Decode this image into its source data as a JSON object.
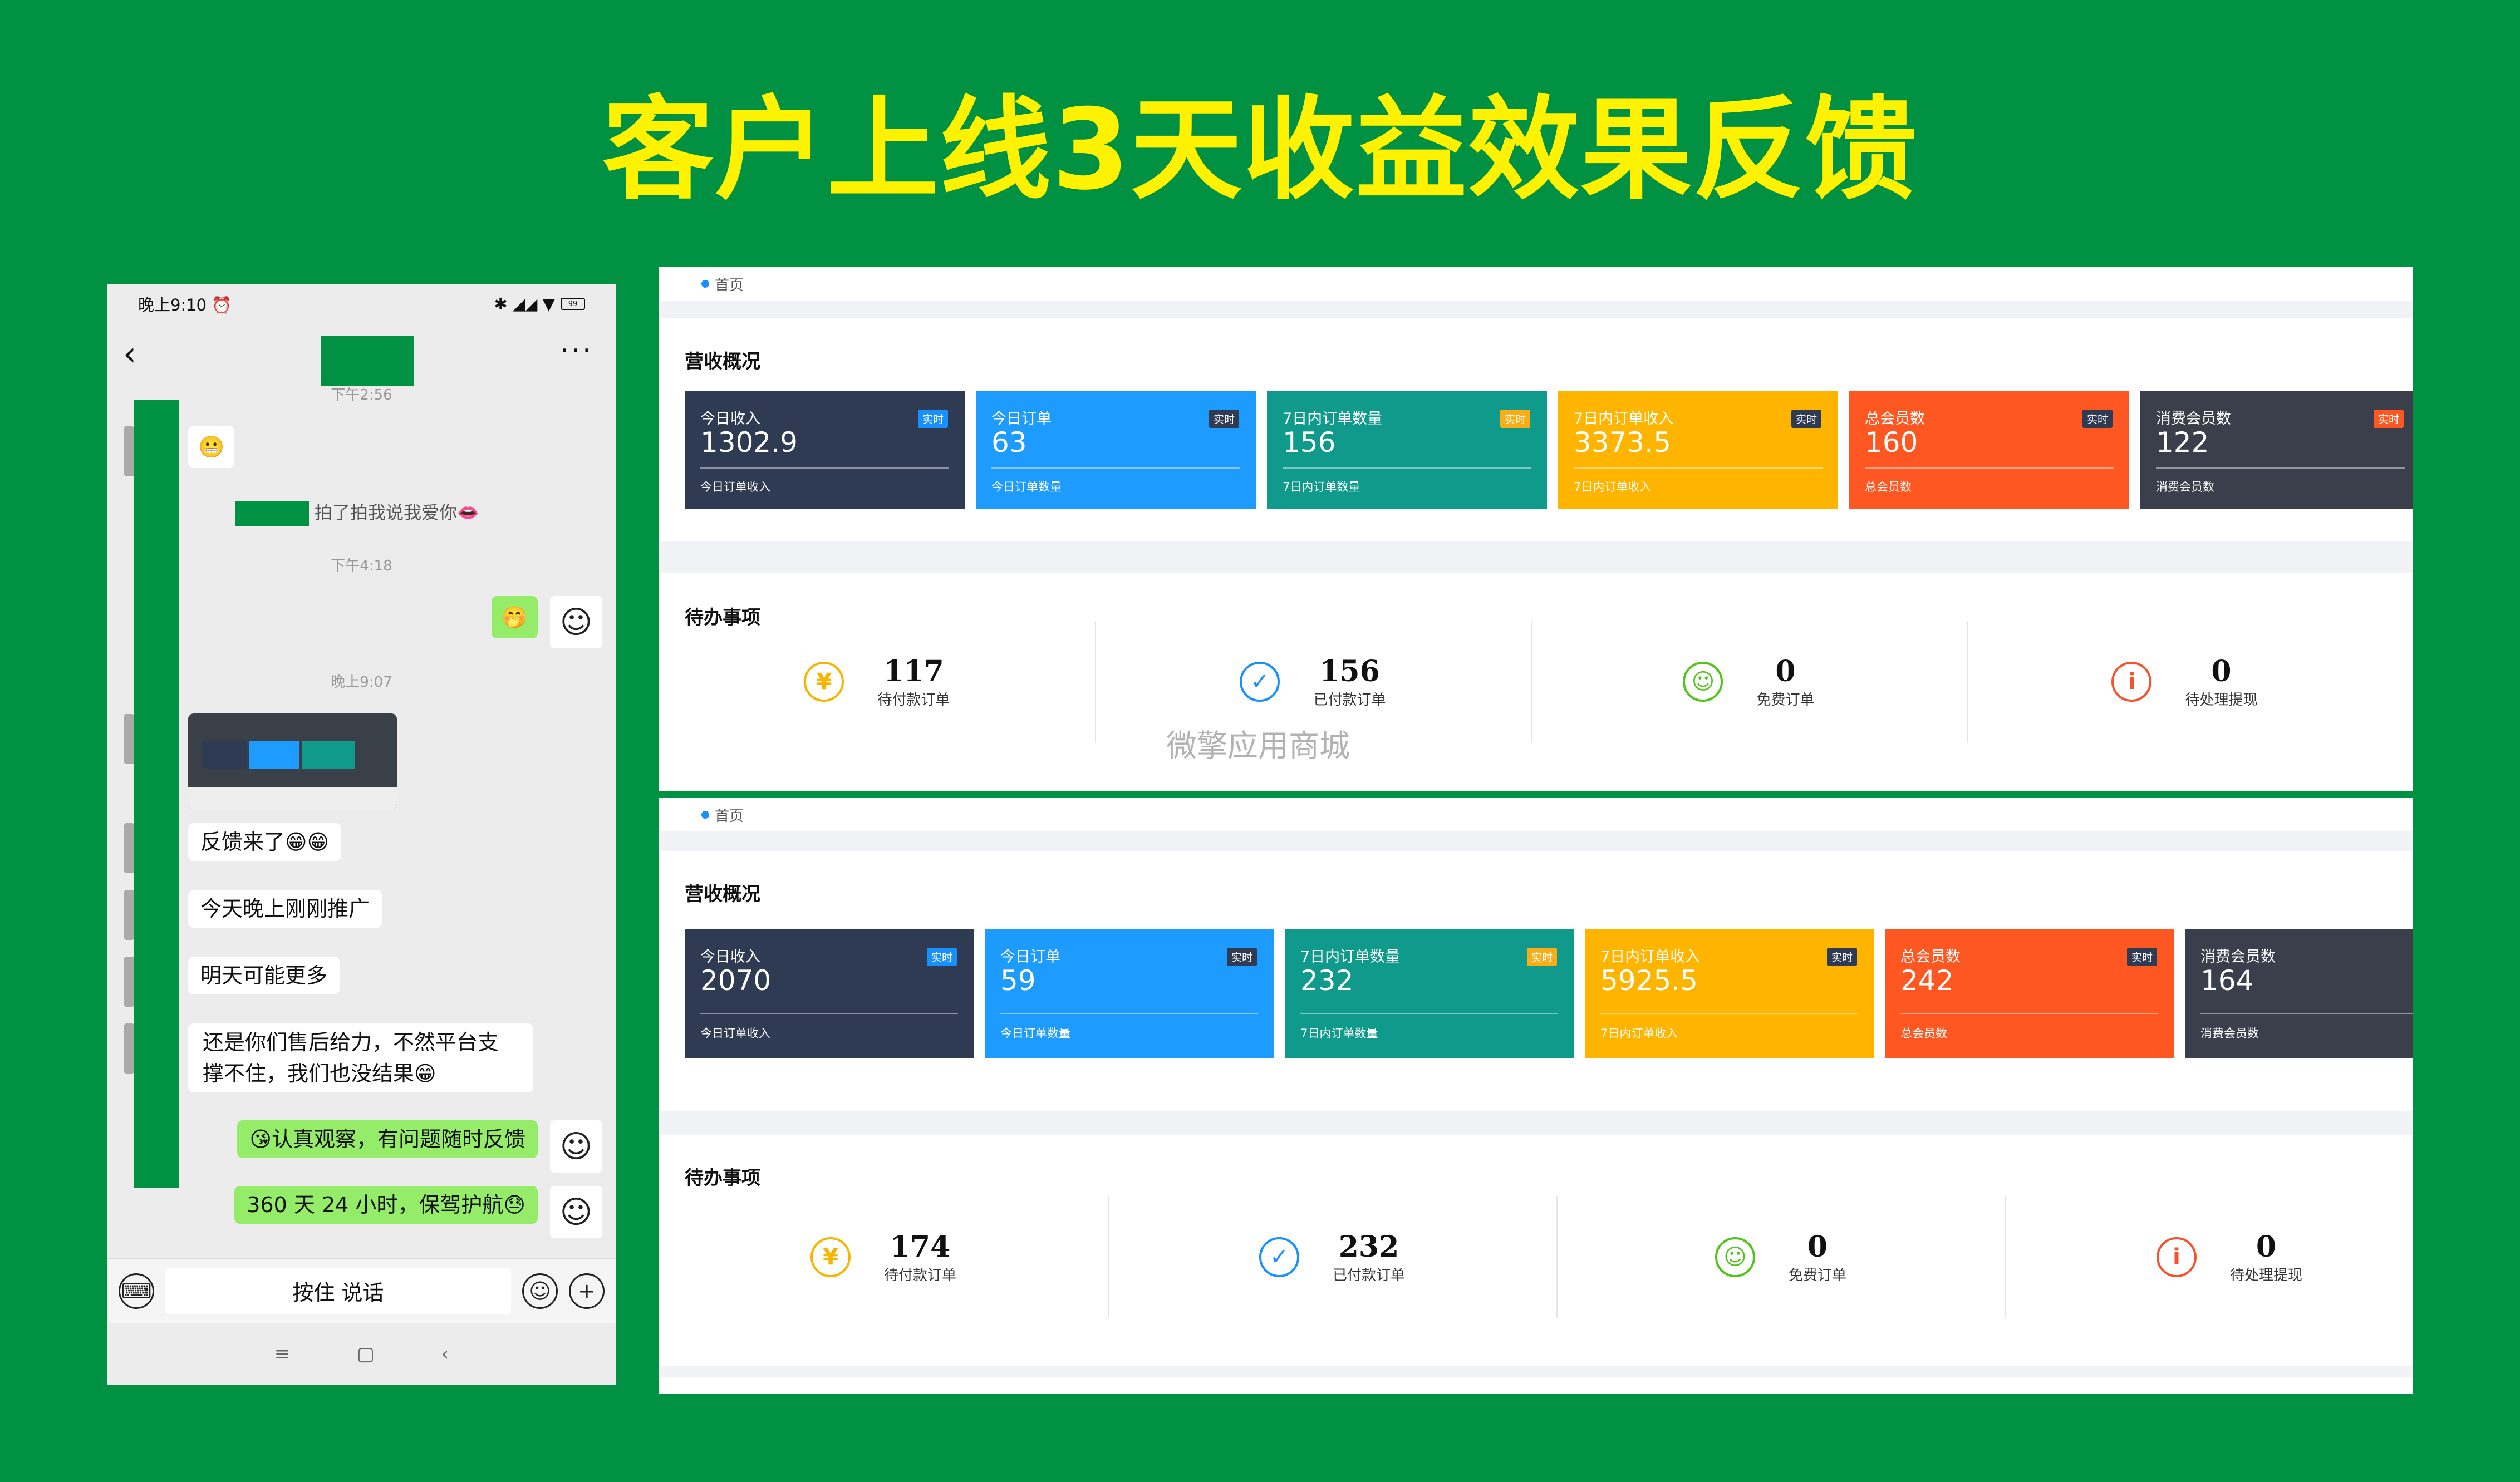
{
  "headline": "客户上线3天收益效果反馈",
  "phone": {
    "status_time": "晚上9:10",
    "status_icon": "alarm-icon",
    "status_icons_right": "✱ ◢◢ ▼",
    "battery": "99",
    "times": [
      "下午2:56",
      "下午4:18",
      "晚上9:07"
    ],
    "messages": [
      {
        "side": "left",
        "text": "😬"
      },
      {
        "side": "system",
        "text": "拍了拍我说我爱你👄"
      },
      {
        "side": "right",
        "text": "🤭"
      },
      {
        "side": "left",
        "text": "反馈来了😁😁"
      },
      {
        "side": "left",
        "text": "今天晚上刚刚推广"
      },
      {
        "side": "left",
        "text": "明天可能更多"
      },
      {
        "side": "left",
        "text": "还是你们售后给力，不然平台支撑不住，我们也没结果😁"
      },
      {
        "side": "right",
        "text": "😘认真观察，有问题随时反馈"
      },
      {
        "side": "right",
        "text": "360 天 24 小时，保驾护航😓"
      }
    ],
    "voice_label": "按住 说话",
    "sys_nav": [
      "≡",
      "▢",
      "‹"
    ]
  },
  "dashboard_1": {
    "tab": "首页",
    "revenue_title": "营收概况",
    "cards": [
      {
        "label": "今日收入",
        "value": "1302.9",
        "tag": "实时",
        "sub": "今日订单收入",
        "color": "#2f3b52",
        "tag_color": "#1890ff"
      },
      {
        "label": "今日订单",
        "value": "63",
        "tag": "实时",
        "sub": "今日订单数量",
        "color": "#1e9bff",
        "tag_color": "#2f3b52"
      },
      {
        "label": "7日内订单数量",
        "value": "156",
        "tag": "实时",
        "sub": "7日内订单数量",
        "color": "#0f9a8c",
        "tag_color": "#faad14"
      },
      {
        "label": "7日内订单收入",
        "value": "3373.5",
        "tag": "实时",
        "sub": "7日内订单收入",
        "color": "#ffb400",
        "tag_color": "#2f3b52"
      },
      {
        "label": "总会员数",
        "value": "160",
        "tag": "实时",
        "sub": "总会员数",
        "color": "#ff5722",
        "tag_color": "#2f3b52"
      },
      {
        "label": "消费会员数",
        "value": "122",
        "tag": "实时",
        "sub": "消费会员数",
        "color": "#3a3f4b",
        "tag_color": "#ff5722"
      }
    ],
    "todo_title": "待办事项",
    "todos": [
      {
        "num": "117",
        "caption": "待付款订单",
        "icon": "yen-icon",
        "glyph": "¥",
        "color": "#f7b500"
      },
      {
        "num": "156",
        "caption": "已付款订单",
        "icon": "shield-check-icon",
        "glyph": "✓",
        "color": "#1890ff"
      },
      {
        "num": "0",
        "caption": "免费订单",
        "icon": "smile-icon",
        "glyph": "☺",
        "color": "#52c41a"
      },
      {
        "num": "0",
        "caption": "待处理提现",
        "icon": "info-icon",
        "glyph": "i",
        "color": "#f5522d"
      }
    ],
    "watermark": "微擎应用商城"
  },
  "dashboard_2": {
    "tab": "首页",
    "revenue_title": "营收概况",
    "cards": [
      {
        "label": "今日收入",
        "value": "2070",
        "tag": "实时",
        "sub": "今日订单收入",
        "color": "#2f3b52",
        "tag_color": "#1890ff"
      },
      {
        "label": "今日订单",
        "value": "59",
        "tag": "实时",
        "sub": "今日订单数量",
        "color": "#1e9bff",
        "tag_color": "#2f3b52"
      },
      {
        "label": "7日内订单数量",
        "value": "232",
        "tag": "实时",
        "sub": "7日内订单数量",
        "color": "#0f9a8c",
        "tag_color": "#faad14"
      },
      {
        "label": "7日内订单收入",
        "value": "5925.5",
        "tag": "实时",
        "sub": "7日内订单收入",
        "color": "#ffb400",
        "tag_color": "#2f3b52"
      },
      {
        "label": "总会员数",
        "value": "242",
        "tag": "实时",
        "sub": "总会员数",
        "color": "#ff5722",
        "tag_color": "#2f3b52"
      },
      {
        "label": "消费会员数",
        "value": "164",
        "tag": "",
        "sub": "消费会员数",
        "color": "#3a3f4b",
        "tag_color": "#ff5722"
      }
    ],
    "todo_title": "待办事项",
    "todos": [
      {
        "num": "174",
        "caption": "待付款订单",
        "icon": "yen-icon",
        "glyph": "¥",
        "color": "#f7b500"
      },
      {
        "num": "232",
        "caption": "已付款订单",
        "icon": "shield-check-icon",
        "glyph": "✓",
        "color": "#1890ff"
      },
      {
        "num": "0",
        "caption": "免费订单",
        "icon": "smile-icon",
        "glyph": "☺",
        "color": "#52c41a"
      },
      {
        "num": "0",
        "caption": "待处理提现",
        "icon": "info-icon",
        "glyph": "i",
        "color": "#f5522d"
      }
    ]
  }
}
